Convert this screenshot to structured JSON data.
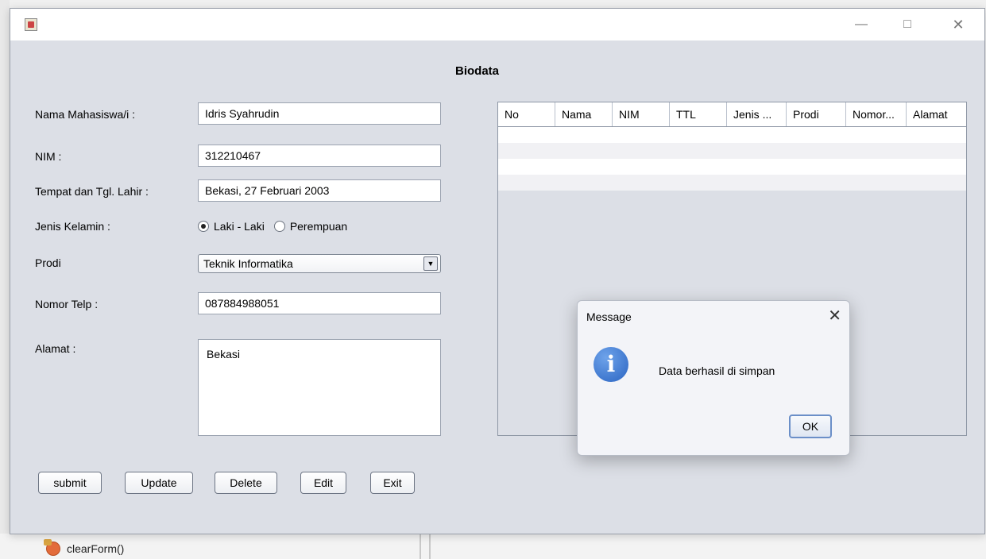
{
  "window": {
    "title_icon": "java-app-icon",
    "form_title": "Biodata"
  },
  "form": {
    "nama_label": "Nama Mahasiswa/i  :",
    "nama_value": "Idris Syahrudin",
    "nim_label": "NIM :",
    "nim_value": "312210467",
    "ttl_label": "Tempat dan Tgl. Lahir :",
    "ttl_value": "Bekasi, 27 Februari 2003",
    "jk_label": "Jenis Kelamin :",
    "jk_option_male": "Laki - Laki",
    "jk_option_female": "Perempuan",
    "prodi_label": "Prodi",
    "prodi_value": "Teknik Informatika",
    "telp_label": "Nomor Telp :",
    "telp_value": "087884988051",
    "alamat_label": "Alamat :",
    "alamat_value": "Bekasi"
  },
  "buttons": {
    "submit": "submit",
    "update": "Update",
    "delete": "Delete",
    "edit": "Edit",
    "exit": "Exit"
  },
  "table": {
    "columns": [
      "No",
      "Nama",
      "NIM",
      "TTL",
      "Jenis ...",
      "Prodi",
      "Nomor...",
      "Alamat"
    ]
  },
  "dialog": {
    "title": "Message",
    "message": "Data berhasil di simpan",
    "ok": "OK"
  },
  "background": {
    "method_label": "clearForm()"
  }
}
